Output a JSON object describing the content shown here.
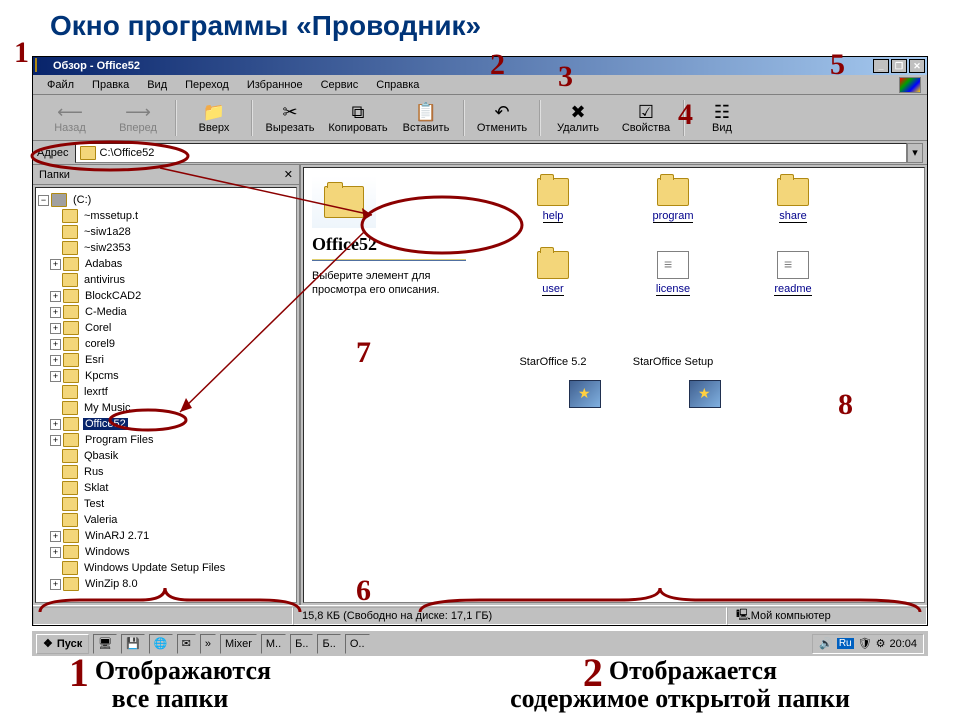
{
  "slide_title": "Окно  программы  «Проводник»",
  "titlebar": {
    "text": "Обзор - Office52"
  },
  "menu": [
    "Файл",
    "Правка",
    "Вид",
    "Переход",
    "Избранное",
    "Сервис",
    "Справка"
  ],
  "toolbar": {
    "back": "Назад",
    "forward": "Вперед",
    "up": "Вверх",
    "cut": "Вырезать",
    "copy": "Копировать",
    "paste": "Вставить",
    "undo": "Отменить",
    "delete": "Удалить",
    "properties": "Свойства",
    "views": "Вид"
  },
  "address": {
    "label": "Адрес",
    "value": "C:\\Office52"
  },
  "tree": {
    "header": "Папки",
    "root": "(C:)",
    "items": [
      "~mssetup.t",
      "~siw1a28",
      "~siw2353",
      "Adabas",
      "antivirus",
      "BlockCAD2",
      "C-Media",
      "Corel",
      "corel9",
      "Esri",
      "Kpcms",
      "lexrtf",
      "My Music",
      "Office52",
      "Program Files",
      "Qbasik",
      "Rus",
      "Sklat",
      "Test",
      "Valeria",
      "WinARJ 2.71",
      "Windows",
      "Windows Update Setup Files",
      "WinZip 8.0"
    ],
    "selected": "Office52"
  },
  "info": {
    "title": "Office52",
    "hint": "Выберите элемент для просмотра его описания."
  },
  "grid": {
    "row1": [
      {
        "name": "help",
        "kind": "folder"
      },
      {
        "name": "program",
        "kind": "folder"
      },
      {
        "name": "share",
        "kind": "folder"
      }
    ],
    "row2": [
      {
        "name": "user",
        "kind": "folder"
      },
      {
        "name": "license",
        "kind": "doc"
      },
      {
        "name": "readme",
        "kind": "doc"
      }
    ],
    "row3": [
      {
        "name": "StarOffice 5.2",
        "kind": "app"
      },
      {
        "name": "StarOffice Setup",
        "kind": "app"
      }
    ]
  },
  "status": {
    "left": "",
    "mid": "15,8 КБ (Свободно на диске: 17,1 ГБ)",
    "right": "Мой компьютер"
  },
  "taskbar": {
    "start": "Пуск",
    "items": [
      "Mixer",
      "M..",
      "Б..",
      "Б..",
      "О.."
    ],
    "lang": "Ru",
    "time": "20:04"
  },
  "annotations": {
    "n1": "1",
    "n2": "2",
    "n3": "3",
    "n4": "4",
    "n5": "5",
    "n6": "6",
    "n7": "7",
    "n8": "8",
    "cap1_num": "1",
    "cap1": "Отображаются\nвсе  папки",
    "cap2_num": "2",
    "cap2": "Отображается\nсодержимое  открытой  папки"
  }
}
